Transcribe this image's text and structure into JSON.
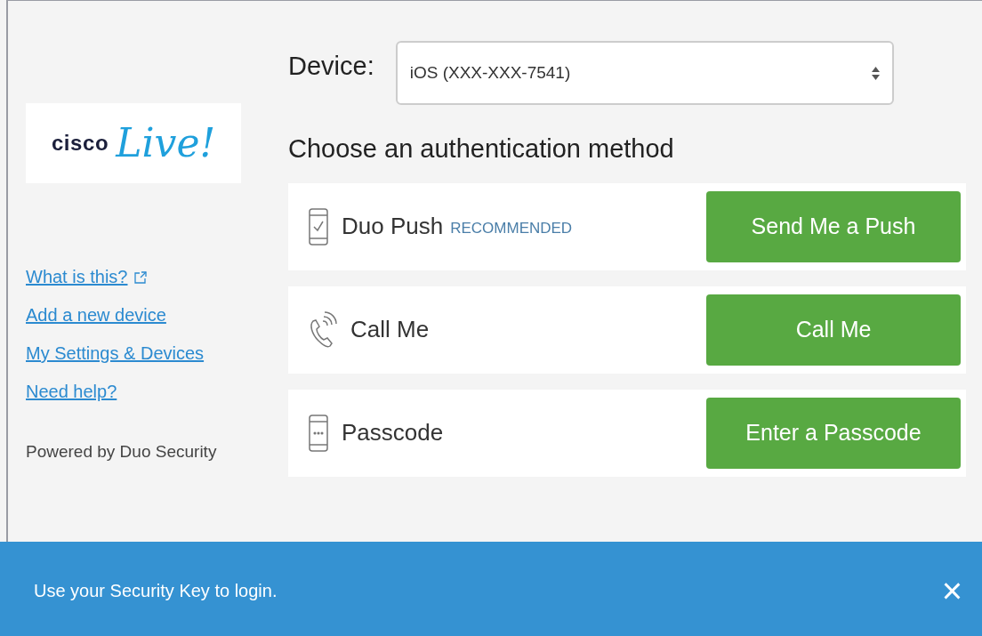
{
  "logo": {
    "word": "cisco",
    "script": "Live!"
  },
  "links": [
    {
      "label": "What is this?",
      "external": true
    },
    {
      "label": "Add a new device",
      "external": false
    },
    {
      "label": "My Settings & Devices",
      "external": false
    },
    {
      "label": "Need help?",
      "external": false
    }
  ],
  "powered_by": "Powered by Duo Security",
  "device": {
    "label": "Device:",
    "value": "iOS (XXX-XXX-7541)"
  },
  "heading": "Choose an authentication method",
  "methods": [
    {
      "kind": "push",
      "label": "Duo Push",
      "badge": "RECOMMENDED",
      "button": "Send Me a Push"
    },
    {
      "kind": "call",
      "label": "Call Me",
      "button": "Call Me"
    },
    {
      "kind": "passcode",
      "label": "Passcode",
      "button": "Enter a Passcode"
    }
  ],
  "banner": {
    "message": "Use your Security Key to login.",
    "close": "×"
  }
}
